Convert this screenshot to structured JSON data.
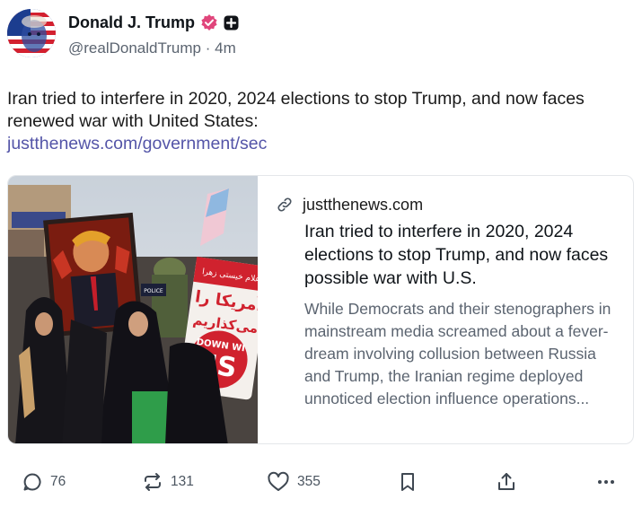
{
  "author": {
    "display_name": "Donald J. Trump",
    "handle": "@realDonaldTrump",
    "separator": "·",
    "time_ago": "4m"
  },
  "post": {
    "text": "Iran tried to interfere in 2020, 2024 elections to stop Trump, and now faces renewed war with United States:",
    "link": "justthenews.com/government/sec"
  },
  "card": {
    "domain": "justthenews.com",
    "title": "Iran tried to interfere in 2020, 2024 elections to stop Trump, and now faces possible war with U.S.",
    "description": "While Democrats and their stenographers in mainstream media screamed about a fever-dream involving collusion between Russia and Trump, the Iranian regime deployed unnoticed election influence operations...",
    "sign_text_1": "آمریکا را",
    "sign_text_2": "می‌کذاریم",
    "sign_text_3": "DOWN WI",
    "sign_text_4": "US",
    "sign_text_top": "اعلام خیستی زهرا",
    "police_text": "POLICE"
  },
  "actions": {
    "replies": "76",
    "reposts": "131",
    "likes": "355"
  },
  "icons": [
    "verified-icon",
    "plus-badge-icon",
    "link-icon",
    "reply-icon",
    "repost-icon",
    "like-icon",
    "bookmark-icon",
    "share-icon",
    "more-icon"
  ],
  "colors": {
    "verified": "#e0457b",
    "link": "#5455a8",
    "muted": "#5b6470"
  }
}
